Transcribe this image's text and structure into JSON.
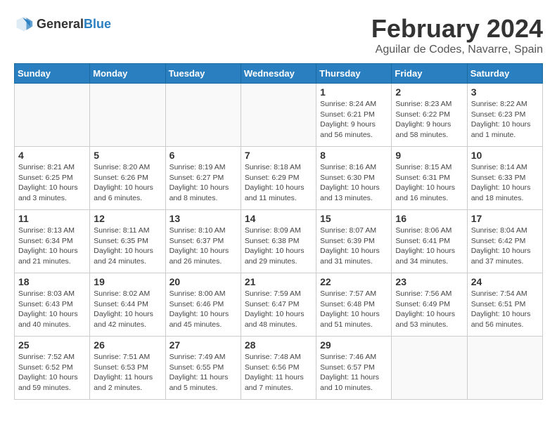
{
  "logo": {
    "general": "General",
    "blue": "Blue"
  },
  "header": {
    "month": "February 2024",
    "location": "Aguilar de Codes, Navarre, Spain"
  },
  "weekdays": [
    "Sunday",
    "Monday",
    "Tuesday",
    "Wednesday",
    "Thursday",
    "Friday",
    "Saturday"
  ],
  "weeks": [
    [
      {
        "day": "",
        "info": ""
      },
      {
        "day": "",
        "info": ""
      },
      {
        "day": "",
        "info": ""
      },
      {
        "day": "",
        "info": ""
      },
      {
        "day": "1",
        "info": "Sunrise: 8:24 AM\nSunset: 6:21 PM\nDaylight: 9 hours\nand 56 minutes."
      },
      {
        "day": "2",
        "info": "Sunrise: 8:23 AM\nSunset: 6:22 PM\nDaylight: 9 hours\nand 58 minutes."
      },
      {
        "day": "3",
        "info": "Sunrise: 8:22 AM\nSunset: 6:23 PM\nDaylight: 10 hours\nand 1 minute."
      }
    ],
    [
      {
        "day": "4",
        "info": "Sunrise: 8:21 AM\nSunset: 6:25 PM\nDaylight: 10 hours\nand 3 minutes."
      },
      {
        "day": "5",
        "info": "Sunrise: 8:20 AM\nSunset: 6:26 PM\nDaylight: 10 hours\nand 6 minutes."
      },
      {
        "day": "6",
        "info": "Sunrise: 8:19 AM\nSunset: 6:27 PM\nDaylight: 10 hours\nand 8 minutes."
      },
      {
        "day": "7",
        "info": "Sunrise: 8:18 AM\nSunset: 6:29 PM\nDaylight: 10 hours\nand 11 minutes."
      },
      {
        "day": "8",
        "info": "Sunrise: 8:16 AM\nSunset: 6:30 PM\nDaylight: 10 hours\nand 13 minutes."
      },
      {
        "day": "9",
        "info": "Sunrise: 8:15 AM\nSunset: 6:31 PM\nDaylight: 10 hours\nand 16 minutes."
      },
      {
        "day": "10",
        "info": "Sunrise: 8:14 AM\nSunset: 6:33 PM\nDaylight: 10 hours\nand 18 minutes."
      }
    ],
    [
      {
        "day": "11",
        "info": "Sunrise: 8:13 AM\nSunset: 6:34 PM\nDaylight: 10 hours\nand 21 minutes."
      },
      {
        "day": "12",
        "info": "Sunrise: 8:11 AM\nSunset: 6:35 PM\nDaylight: 10 hours\nand 24 minutes."
      },
      {
        "day": "13",
        "info": "Sunrise: 8:10 AM\nSunset: 6:37 PM\nDaylight: 10 hours\nand 26 minutes."
      },
      {
        "day": "14",
        "info": "Sunrise: 8:09 AM\nSunset: 6:38 PM\nDaylight: 10 hours\nand 29 minutes."
      },
      {
        "day": "15",
        "info": "Sunrise: 8:07 AM\nSunset: 6:39 PM\nDaylight: 10 hours\nand 31 minutes."
      },
      {
        "day": "16",
        "info": "Sunrise: 8:06 AM\nSunset: 6:41 PM\nDaylight: 10 hours\nand 34 minutes."
      },
      {
        "day": "17",
        "info": "Sunrise: 8:04 AM\nSunset: 6:42 PM\nDaylight: 10 hours\nand 37 minutes."
      }
    ],
    [
      {
        "day": "18",
        "info": "Sunrise: 8:03 AM\nSunset: 6:43 PM\nDaylight: 10 hours\nand 40 minutes."
      },
      {
        "day": "19",
        "info": "Sunrise: 8:02 AM\nSunset: 6:44 PM\nDaylight: 10 hours\nand 42 minutes."
      },
      {
        "day": "20",
        "info": "Sunrise: 8:00 AM\nSunset: 6:46 PM\nDaylight: 10 hours\nand 45 minutes."
      },
      {
        "day": "21",
        "info": "Sunrise: 7:59 AM\nSunset: 6:47 PM\nDaylight: 10 hours\nand 48 minutes."
      },
      {
        "day": "22",
        "info": "Sunrise: 7:57 AM\nSunset: 6:48 PM\nDaylight: 10 hours\nand 51 minutes."
      },
      {
        "day": "23",
        "info": "Sunrise: 7:56 AM\nSunset: 6:49 PM\nDaylight: 10 hours\nand 53 minutes."
      },
      {
        "day": "24",
        "info": "Sunrise: 7:54 AM\nSunset: 6:51 PM\nDaylight: 10 hours\nand 56 minutes."
      }
    ],
    [
      {
        "day": "25",
        "info": "Sunrise: 7:52 AM\nSunset: 6:52 PM\nDaylight: 10 hours\nand 59 minutes."
      },
      {
        "day": "26",
        "info": "Sunrise: 7:51 AM\nSunset: 6:53 PM\nDaylight: 11 hours\nand 2 minutes."
      },
      {
        "day": "27",
        "info": "Sunrise: 7:49 AM\nSunset: 6:55 PM\nDaylight: 11 hours\nand 5 minutes."
      },
      {
        "day": "28",
        "info": "Sunrise: 7:48 AM\nSunset: 6:56 PM\nDaylight: 11 hours\nand 7 minutes."
      },
      {
        "day": "29",
        "info": "Sunrise: 7:46 AM\nSunset: 6:57 PM\nDaylight: 11 hours\nand 10 minutes."
      },
      {
        "day": "",
        "info": ""
      },
      {
        "day": "",
        "info": ""
      }
    ]
  ]
}
